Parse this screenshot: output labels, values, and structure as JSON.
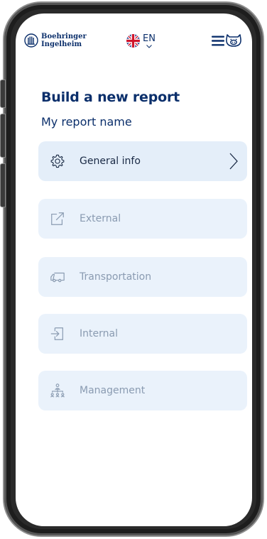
{
  "brand": {
    "line1": "Boehringer",
    "line2": "Ingelheim"
  },
  "language": {
    "code": "EN",
    "flag": "uk-flag-icon"
  },
  "header": {
    "menu_icon": "hamburger-menu-icon",
    "mascot_icon": "pig-icon"
  },
  "title": "Build a new report",
  "report_name": "My report name",
  "sections": [
    {
      "label": "General info",
      "icon": "gear-icon",
      "enabled": true
    },
    {
      "label": "External",
      "icon": "external-link-icon",
      "enabled": false
    },
    {
      "label": "Transportation",
      "icon": "truck-icon",
      "enabled": false
    },
    {
      "label": "Internal",
      "icon": "sign-in-icon",
      "enabled": false
    },
    {
      "label": "Management",
      "icon": "org-chart-icon",
      "enabled": false
    }
  ],
  "colors": {
    "brand_navy": "#0b2f6b",
    "card_active": "#e4eef9",
    "card_disabled": "#eaf2fb",
    "text_disabled": "#8a9bb1"
  }
}
